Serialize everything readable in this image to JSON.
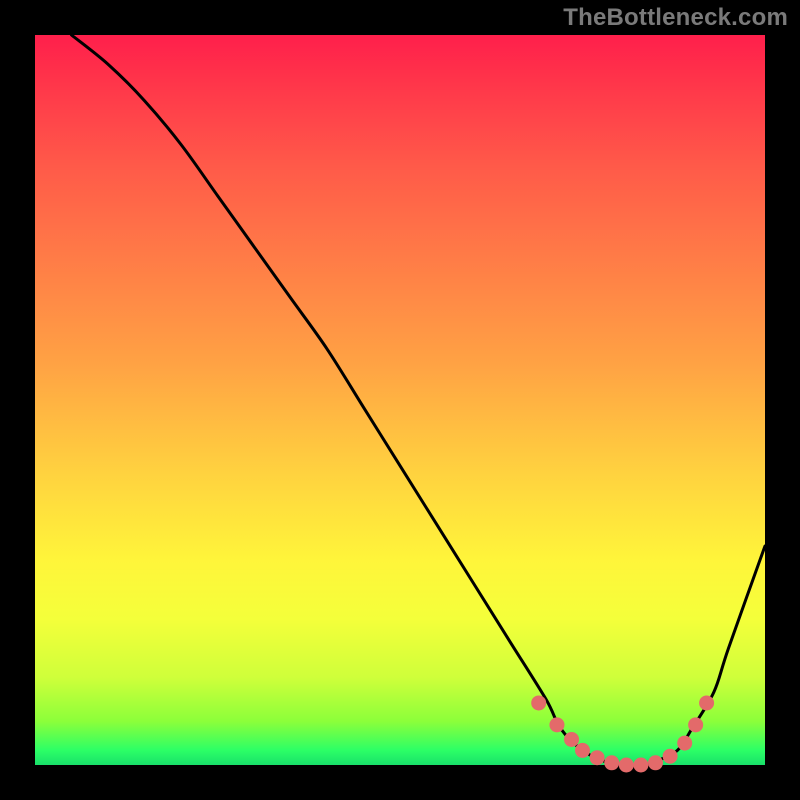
{
  "attribution": "TheBottleneck.com",
  "chart_data": {
    "type": "line",
    "title": "",
    "xlabel": "",
    "ylabel": "",
    "xlim": [
      0,
      100
    ],
    "ylim": [
      0,
      100
    ],
    "series": [
      {
        "name": "bottleneck-curve",
        "x": [
          5,
          10,
          15,
          20,
          25,
          30,
          35,
          40,
          45,
          50,
          55,
          60,
          65,
          70,
          72,
          75,
          78,
          80,
          83,
          85,
          88,
          90,
          93,
          95,
          100
        ],
        "y": [
          100,
          96,
          91,
          85,
          78,
          71,
          64,
          57,
          49,
          41,
          33,
          25,
          17,
          9,
          5,
          2,
          0.5,
          0,
          0,
          0.5,
          2,
          5,
          10,
          16,
          30
        ]
      }
    ],
    "markers": {
      "name": "sweet-spot-dots",
      "color": "#e36a6a",
      "x": [
        69,
        71.5,
        73.5,
        75,
        77,
        79,
        81,
        83,
        85,
        87,
        89,
        90.5,
        92
      ],
      "y": [
        8.5,
        5.5,
        3.5,
        2,
        1,
        0.3,
        0,
        0,
        0.3,
        1.2,
        3,
        5.5,
        8.5
      ]
    },
    "gradient_stops": [
      {
        "pos": 0,
        "color": "#ff1f4b"
      },
      {
        "pos": 18,
        "color": "#ff5a49"
      },
      {
        "pos": 45,
        "color": "#ffa244"
      },
      {
        "pos": 72,
        "color": "#fff53a"
      },
      {
        "pos": 94,
        "color": "#8cff3a"
      },
      {
        "pos": 100,
        "color": "#19e06a"
      }
    ]
  }
}
